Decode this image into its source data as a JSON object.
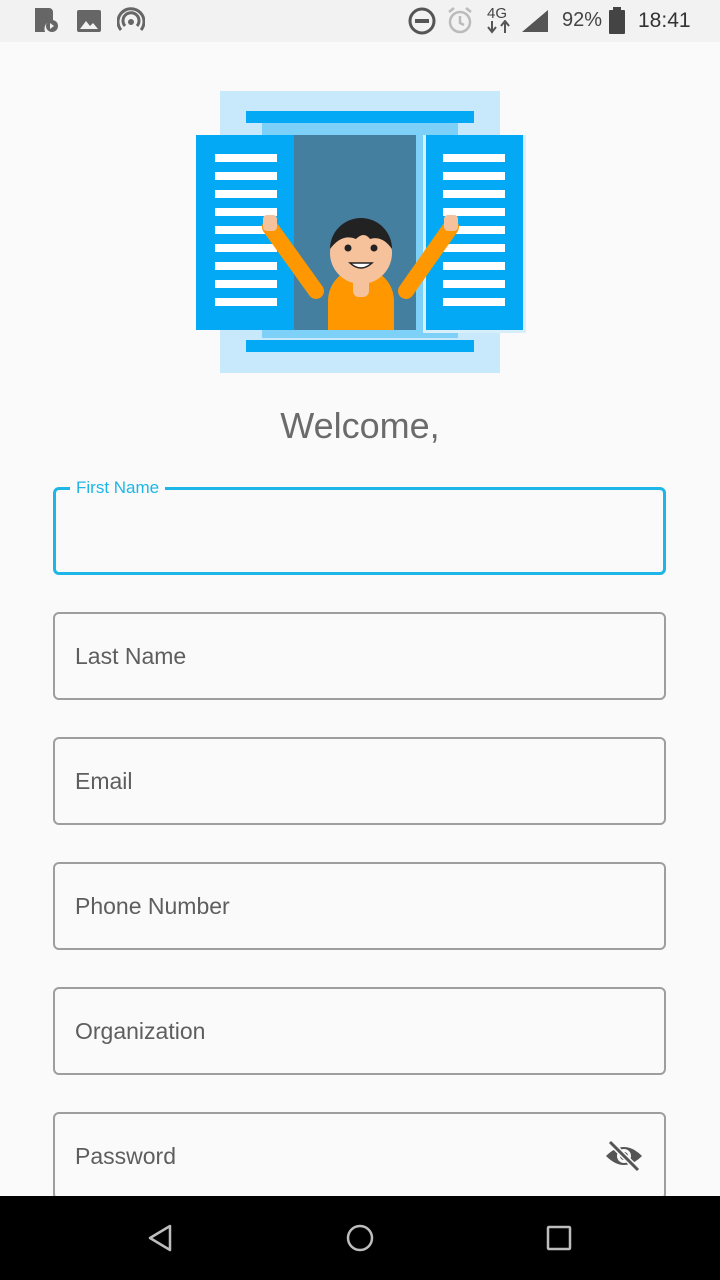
{
  "status_bar": {
    "network": "4G",
    "battery": "92%",
    "time": "18:41"
  },
  "welcome": "Welcome,",
  "fields": {
    "first_name": {
      "label": "First Name",
      "value": ""
    },
    "last_name": {
      "placeholder": "Last Name"
    },
    "email": {
      "placeholder": "Email"
    },
    "phone": {
      "placeholder": "Phone Number"
    },
    "organization": {
      "placeholder": "Organization"
    },
    "password": {
      "placeholder": "Password"
    }
  },
  "icons": {
    "status_left": [
      "user-sync-icon",
      "image-icon",
      "hotspot-icon"
    ],
    "status_right": [
      "do-not-disturb-icon",
      "alarm-icon",
      "data-arrows-icon",
      "signal-icon",
      "battery-icon"
    ],
    "password_toggle": "visibility-off-icon",
    "nav": [
      "back-icon",
      "home-icon",
      "recents-icon"
    ]
  },
  "colors": {
    "accent": "#1eb6e6",
    "shutter": "#03a9f4",
    "window_glass": "#457f9f",
    "shirt": "#ff9800",
    "nav_bar": "#000000"
  }
}
